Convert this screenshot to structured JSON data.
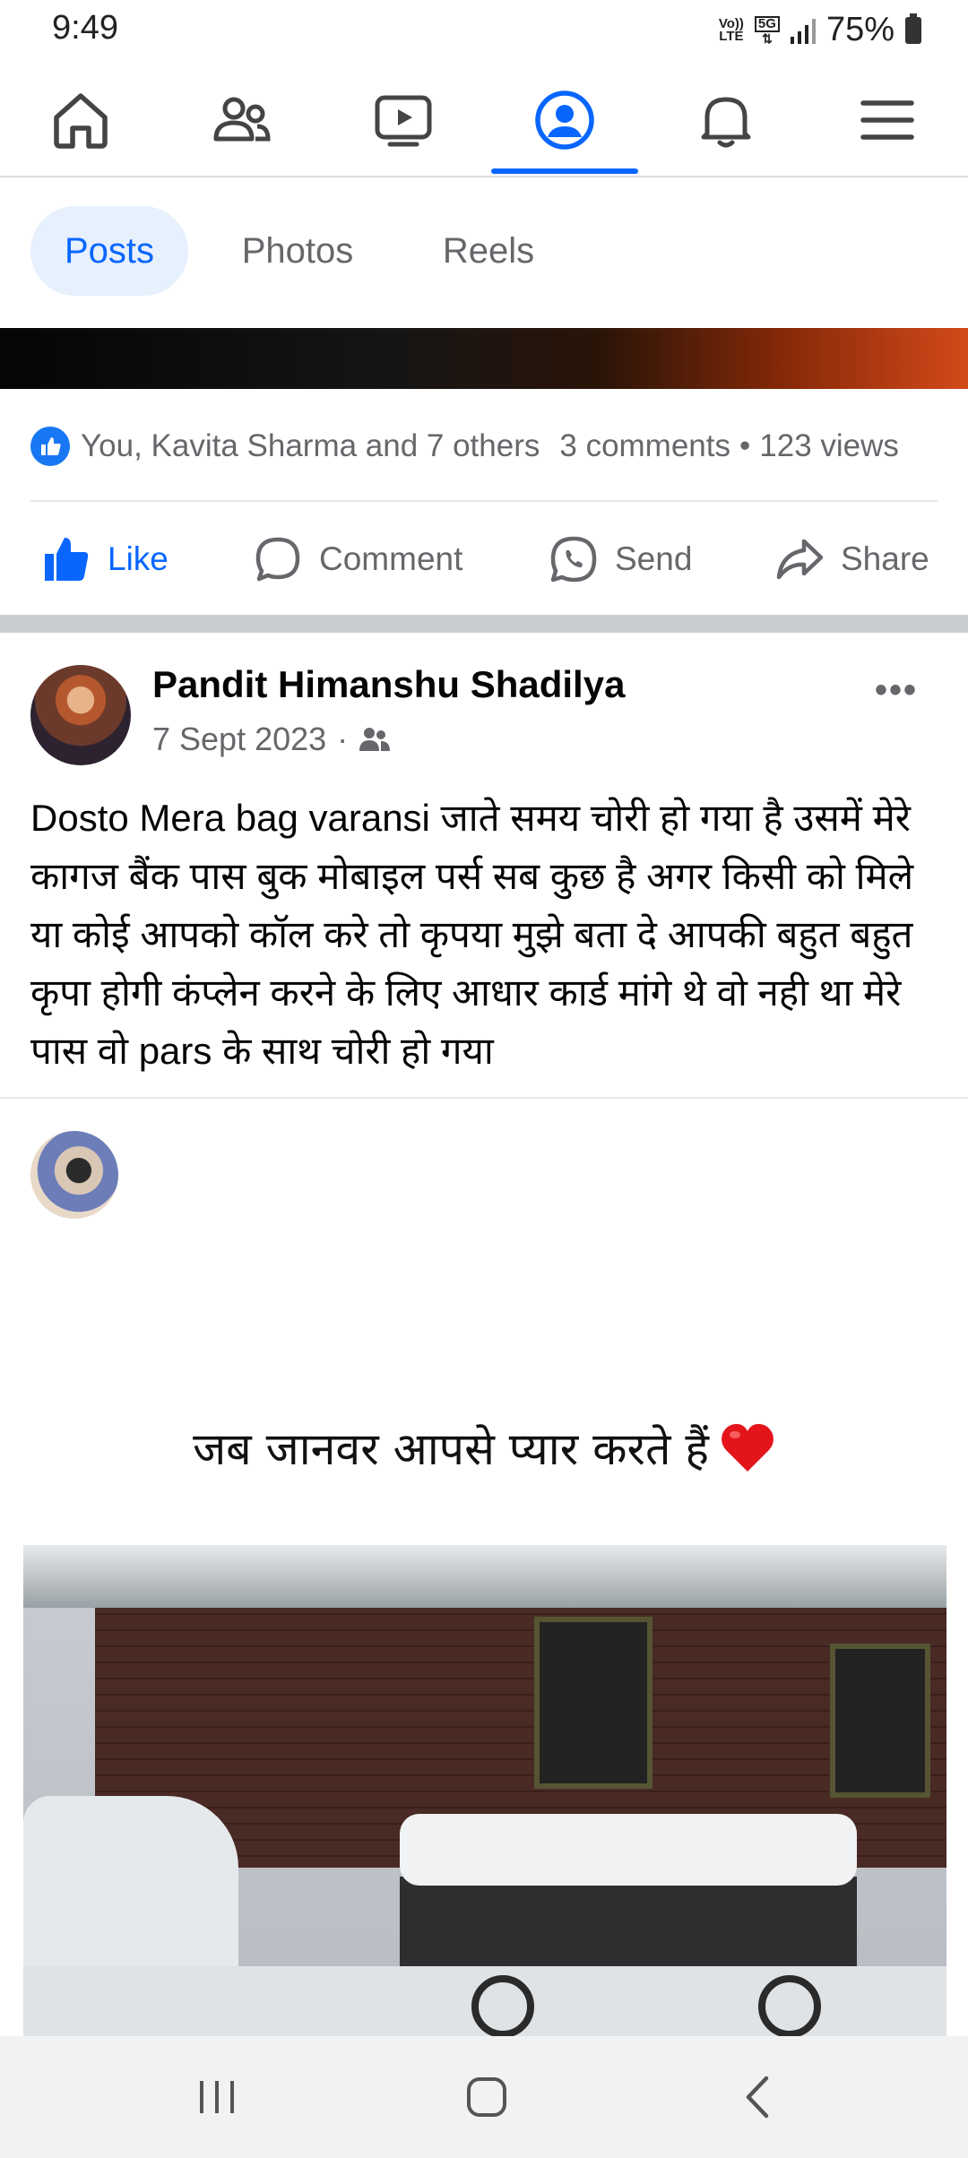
{
  "status_bar": {
    "time": "9:49",
    "volte_top": "Vo))",
    "volte_bottom": "LTE",
    "network": "5G",
    "battery": "75%"
  },
  "top_nav": {
    "items": [
      "home-icon",
      "friends-icon",
      "video-icon",
      "profile-icon",
      "notifications-icon",
      "menu-icon"
    ],
    "active_index": 3,
    "accent_color": "#0866ff"
  },
  "tabs": {
    "posts": "Posts",
    "photos": "Photos",
    "reels": "Reels"
  },
  "previous_post": {
    "reactions_text": "You, Kavita Sharma and 7 others",
    "comments": "3 comments",
    "separator": "•",
    "views": "123 views"
  },
  "actions": {
    "like": "Like",
    "comment": "Comment",
    "send": "Send",
    "share": "Share"
  },
  "post": {
    "author": "Pandit Himanshu Shadilya",
    "date": "7 Sept 2023",
    "dot": "·",
    "audience_icon": "friends-icon",
    "more": "•••",
    "text": "Dosto Mera bag varansi जाते समय चोरी हो गया है उसमें मेरे कागज बैंक पास बुक मोबाइल पर्स सब कुछ है अगर किसी को मिले या कोई आपको कॉल करे तो कृपया मुझे बता दे आपकी बहुत बहुत कृपा होगी कंप्लेन करने के लिए आधार कार्ड मांगे थे वो नही था मेरे पास वो pars के साथ चोरी हो गया"
  },
  "shared_content": {
    "caption": "जब जानवर आपसे प्यार करते हैं",
    "heart_icon": "heart-icon"
  },
  "bottom_nav": {
    "items": [
      "recent-apps-icon",
      "home-button-icon",
      "back-icon"
    ]
  }
}
